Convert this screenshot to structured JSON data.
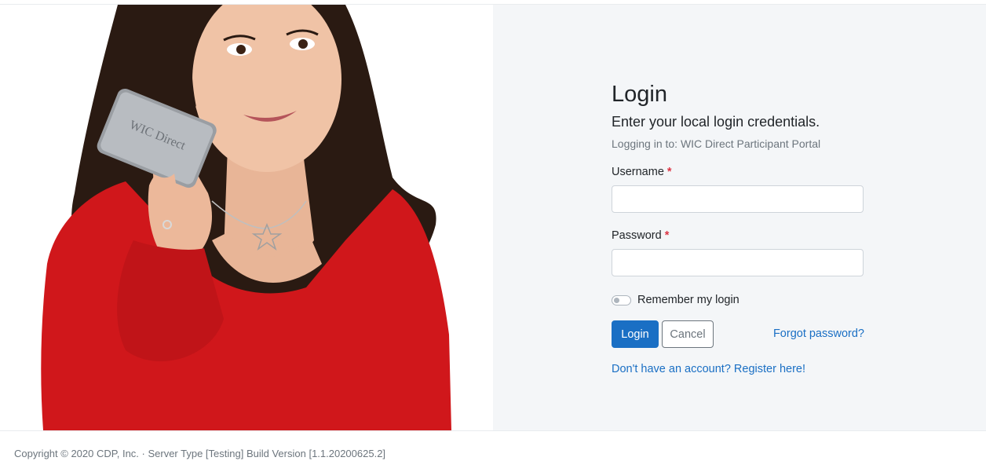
{
  "login": {
    "title": "Login",
    "subtitle": "Enter your local login credentials.",
    "portal_line": "Logging in to: WIC Direct Participant Portal",
    "username_label": "Username",
    "password_label": "Password",
    "required_mark": "*",
    "username_value": "",
    "password_value": "",
    "remember_label": "Remember my login",
    "remember_checked": false,
    "login_button": "Login",
    "cancel_button": "Cancel",
    "forgot_link": "Forgot password?",
    "register_link": "Don't have an account? Register here!"
  },
  "hero": {
    "card_text": "WIC Direct"
  },
  "footer": {
    "text": "Copyright © 2020 CDP, Inc. · Server Type [Testing] Build Version [1.1.20200625.2]"
  },
  "colors": {
    "primary": "#1a6fc4",
    "required": "#dc3545",
    "panel_bg": "#f4f6f8",
    "shirt": "#d0171b"
  }
}
